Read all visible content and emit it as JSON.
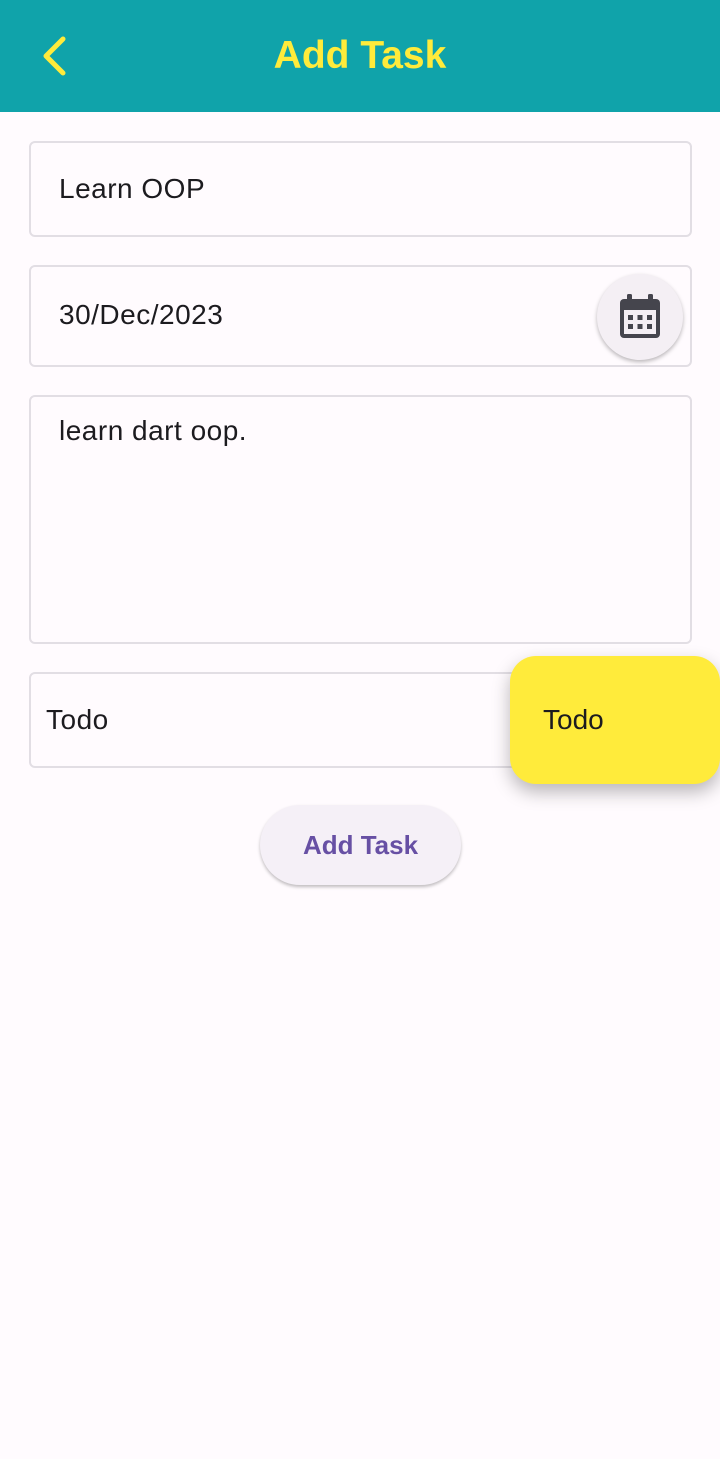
{
  "appbar": {
    "title": "Add Task",
    "back_icon": "chevron-left-icon",
    "background_color": "#10a3aa",
    "title_color": "#ffeb3b"
  },
  "form": {
    "title_value": "Learn OOP",
    "date_value": "30/Dec/2023",
    "calendar_icon": "calendar-icon",
    "description_value": "learn dart oop.",
    "status_value": "Todo"
  },
  "status_menu": {
    "items": [
      "Todo"
    ],
    "background_color": "#ffeb3b"
  },
  "actions": {
    "add_task_label": "Add Task",
    "add_task_color": "#6750a4"
  }
}
